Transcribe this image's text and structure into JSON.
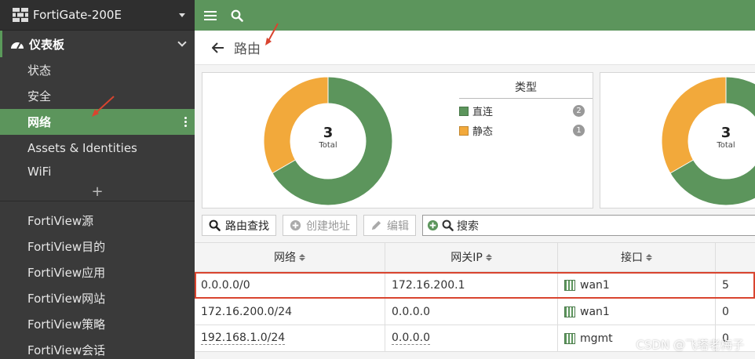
{
  "device": {
    "name": "FortiGate-200E"
  },
  "sidebar": {
    "section": {
      "label": "仪表板"
    },
    "dashboard_items": [
      {
        "label": "状态"
      },
      {
        "label": "安全"
      },
      {
        "label": "网络"
      },
      {
        "label": "Assets & Identities"
      },
      {
        "label": "WiFi"
      }
    ],
    "add_label": "+",
    "fortiview_items": [
      {
        "label": "FortiView源"
      },
      {
        "label": "FortiView目的"
      },
      {
        "label": "FortiView应用"
      },
      {
        "label": "FortiView网站"
      },
      {
        "label": "FortiView策略"
      },
      {
        "label": "FortiView会话"
      }
    ]
  },
  "page": {
    "title": "路由"
  },
  "widget1": {
    "center_number": "3",
    "center_label": "Total",
    "legend_title": "类型",
    "legend": [
      {
        "label": "直连",
        "count": "2",
        "color": "#5c955c"
      },
      {
        "label": "静态",
        "count": "1",
        "color": "#f2a93b"
      }
    ]
  },
  "widget2": {
    "center_number": "3",
    "center_label": "Total"
  },
  "toolbar": {
    "route_lookup": "路由查找",
    "create_address": "创建地址",
    "edit": "编辑",
    "search_placeholder": "搜索"
  },
  "table": {
    "headers": [
      "网络",
      "网关IP",
      "接口",
      ""
    ],
    "rows": [
      {
        "network": "0.0.0.0/0",
        "gateway": "172.16.200.1",
        "interface": "wan1",
        "extra": "5"
      },
      {
        "network": "172.16.200.0/24",
        "gateway": "0.0.0.0",
        "interface": "wan1",
        "extra": "0"
      },
      {
        "network": "192.168.1.0/24",
        "gateway": "0.0.0.0",
        "interface": "mgmt",
        "extra": "0"
      }
    ]
  },
  "watermark": "CSDN @飞塔老梅子",
  "colors": {
    "green": "#5c955c",
    "orange": "#f2a93b",
    "highlight": "#d9442f"
  }
}
